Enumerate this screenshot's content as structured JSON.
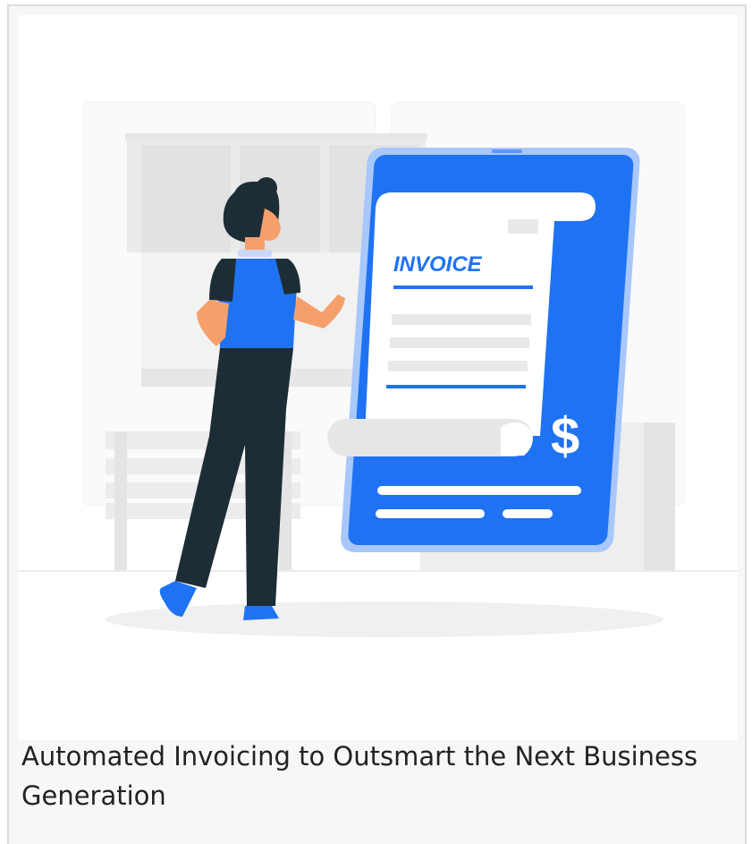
{
  "card": {
    "caption": "Automated Invoicing to Outsmart the Next Business Generation",
    "illustration": {
      "invoice_title": "INVOICE",
      "currency_symbol": "$",
      "icons": [
        "woman-figure",
        "invoice-document",
        "tablet-device",
        "dollar-sign"
      ]
    }
  },
  "colors": {
    "accent": "#1f73f2",
    "dark_outfit": "#1d2d35",
    "skin": "#f5a06b",
    "background_gray": "#efefef",
    "text": "#222222"
  }
}
